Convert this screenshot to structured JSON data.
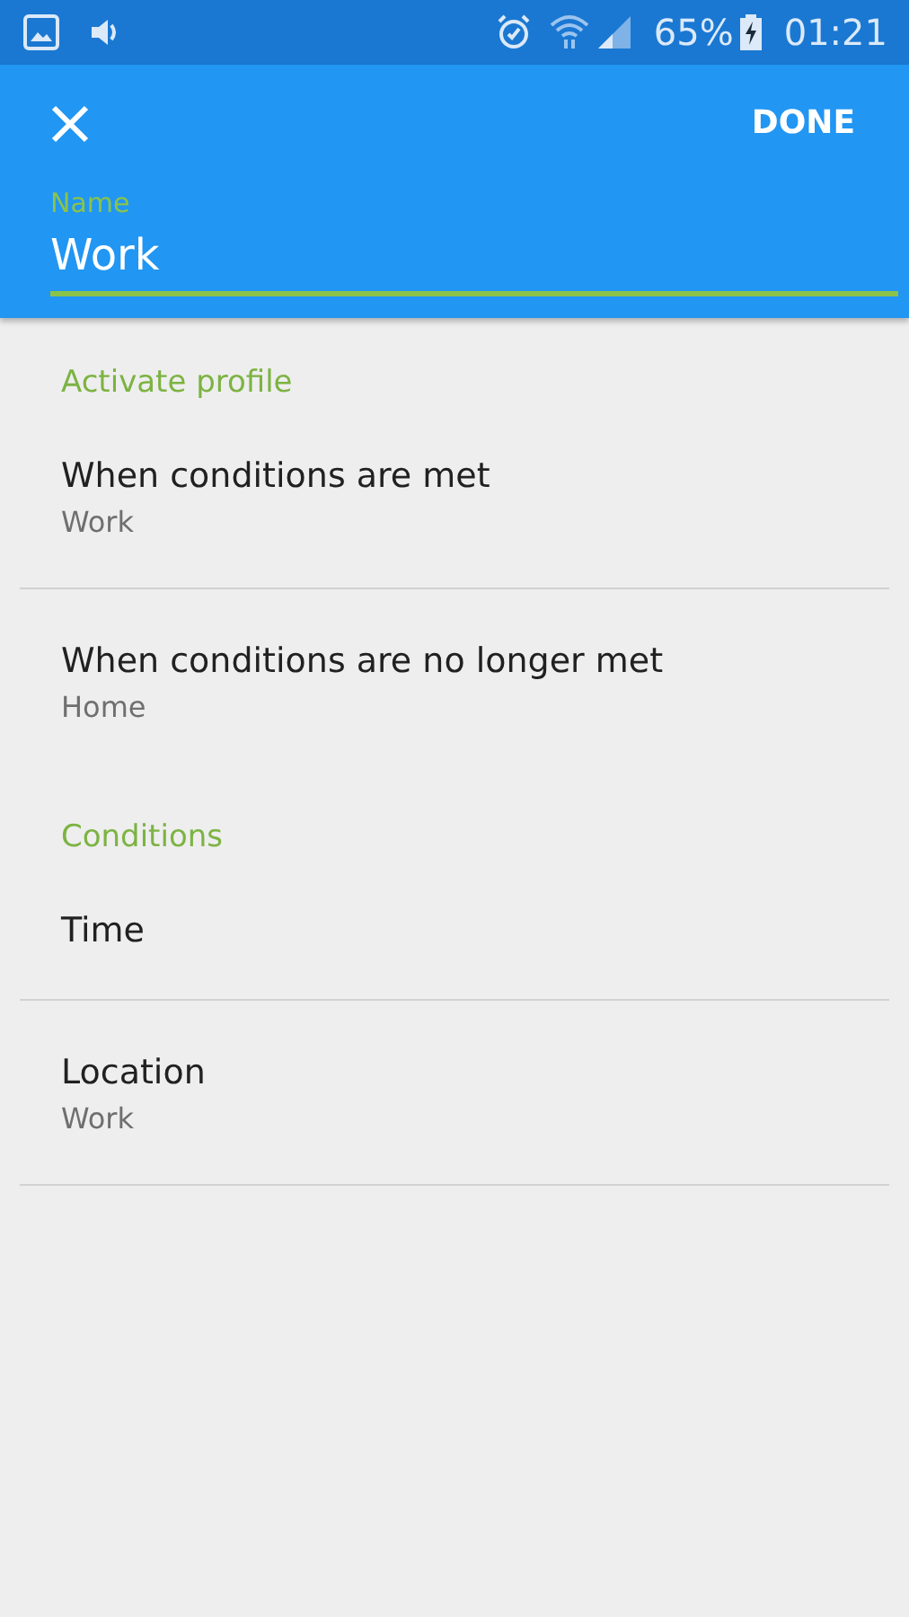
{
  "status_bar": {
    "battery_percent": "65%",
    "time": "01:21"
  },
  "toolbar": {
    "action": "DONE"
  },
  "name_field": {
    "label": "Name",
    "value": "Work"
  },
  "sections": [
    {
      "title": "Activate profile",
      "items": [
        {
          "title": "When conditions are met",
          "subtitle": "Work",
          "divider": true
        },
        {
          "title": "When conditions are no longer met",
          "subtitle": "Home",
          "divider": false
        }
      ]
    },
    {
      "title": "Conditions",
      "items": [
        {
          "title": "Time",
          "divider": true
        },
        {
          "title": "Location",
          "subtitle": "Work",
          "divider": true
        }
      ]
    }
  ]
}
